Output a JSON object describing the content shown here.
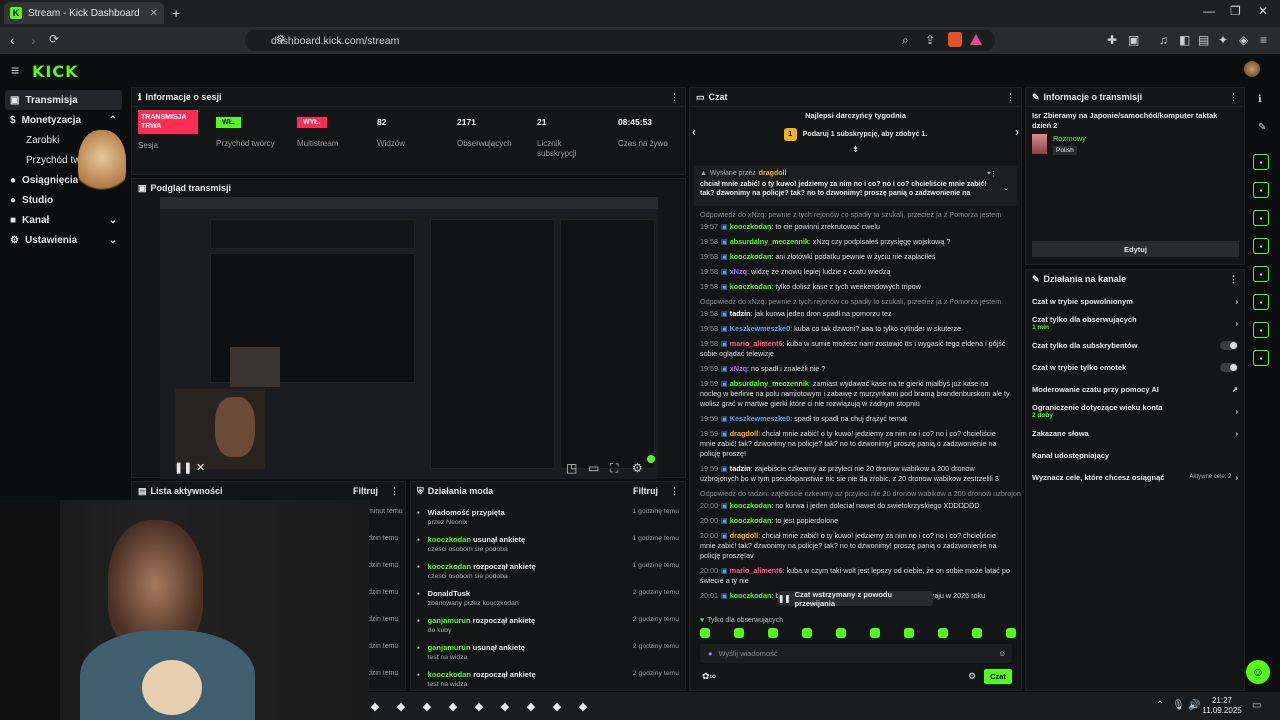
{
  "browser": {
    "tab_title": "Stream - Kick Dashboard",
    "url": "dashboard.kick.com/stream"
  },
  "app": {
    "logo": "KICK"
  },
  "sidebar": {
    "items": [
      {
        "label": "Transmisja",
        "active": true
      },
      {
        "label": "Monetyzacja"
      },
      {
        "label": "Zarobki",
        "sub": true
      },
      {
        "label": "Przychód twórcy",
        "sub": true
      },
      {
        "label": "Osiągnięcia"
      },
      {
        "label": "Studio"
      },
      {
        "label": "Kanał"
      },
      {
        "label": "Ustawienia"
      }
    ]
  },
  "session": {
    "title": "Informacje o sesji",
    "session_label": "Sesja",
    "live_badge": "TRANSMISJA TRWA",
    "creator_badge": "WŁ.",
    "creator_label": "Przychód twórcy",
    "multistream_badge": "WYŁ.",
    "multistream_label": "Multistream",
    "viewers": "82",
    "viewers_label": "Widzów",
    "followers": "2171",
    "followers_label": "Obserwujących",
    "subs": "21",
    "subs_label": "Licznik subskrypcji",
    "time": "08:45:53",
    "time_label": "Czas na żywo"
  },
  "preview": {
    "title": "Podgląd transmisji"
  },
  "activity": {
    "title": "Lista aktywności",
    "filter": "Filtruj",
    "times": [
      "minut temu",
      "dzin temu",
      "dzin temu",
      "dzin temu",
      "dzin temu",
      "dzin temu",
      "dzin temu"
    ]
  },
  "modactions": {
    "title": "Działania moda",
    "filter": "Filtruj",
    "items": [
      {
        "user": "Wiadomość przypięta",
        "action": "",
        "sub": "przez Neonix",
        "time": "1 godzinę temu"
      },
      {
        "user": "kooczkodan",
        "action": " usunął ankietę",
        "sub": "czesci osobom sie podoba",
        "time": "1 godzinę temu"
      },
      {
        "user": "kooczkodan",
        "action": " rozpoczął ankietę",
        "sub": "czesci osobom sie podoba",
        "time": "1 godzinę temu"
      },
      {
        "user": "DonaldTusk",
        "action": "",
        "sub": "zbanowany przez kooczkodan",
        "time": "2 godziny temu"
      },
      {
        "user": "ganjamurun",
        "action": " rozpoczął ankietę",
        "sub": "do kuby",
        "time": "2 godziny temu"
      },
      {
        "user": "ganjamurun",
        "action": " usunął ankietę",
        "sub": "test na widza",
        "time": "2 godziny temu"
      },
      {
        "user": "kooczkodan",
        "action": " rozpoczął ankietę",
        "sub": "test na widza",
        "time": "2 godziny temu"
      }
    ]
  },
  "chat": {
    "title": "Czat",
    "top_gifters": "Najlepsi darczyńcy tygodnia",
    "gift_cta": "Podaruj 1 subskrypcję, aby zdobyć 1.",
    "pinned_by": "Wysłane przez",
    "pinned_user": "dragdoll",
    "pinned_msg": "chciał mnie zabić! o ty kuwo! jedziemy za nim no i co? no i co? chcieliście mnie zabić! tak? dzwonimy na policje? tak? no to dzwonimy! proszę panią o zadzwonienie na policję...",
    "paused": "Czat wstrzymany z powodu przewijania",
    "followers_only": "Tylko dla obserwujących",
    "input_placeholder": "Wyślij wiadomość",
    "send": "Czat",
    "messages": [
      {
        "reply": "Odpowiedź do xNzq: pewnie z tych rejonów co spadły to szukali, przecież ja z Pomorza jestem"
      },
      {
        "t": "19:57",
        "u": "kooczkodan",
        "c": "#53fc18",
        "m": "to cie powinni zrekrutować cwelu"
      },
      {
        "t": "19:58",
        "u": "absurdalny_meczennik",
        "c": "#53fc18",
        "m": "xNzq czy podpisałeś przysięgę wojskową ?"
      },
      {
        "t": "19:58",
        "u": "kooczkodan",
        "c": "#53fc18",
        "m": "ani złotówki podatku pewnie w życiu nie zapłaciłeś"
      },
      {
        "t": "19:58",
        "u": "xNzq",
        "c": "#b26bff",
        "m": "widzę że znowu lepiej ludzie z czatu wiedzą"
      },
      {
        "t": "19:58",
        "u": "kooczkodan",
        "c": "#53fc18",
        "m": "tylko dolisz kase z tych weekendowych tripow"
      },
      {
        "reply": "Odpowiedź do xNzq: pewnie z tych rejonów co spadły to szukali, przecież ja z Pomorza jestem"
      },
      {
        "t": "19:58",
        "u": "tadzin",
        "c": "#ffffff",
        "m": "jak kurwa jeden dron spadł na pomorzu tez"
      },
      {
        "t": "19:58",
        "u": "Keszkewmeszke0",
        "c": "#4fa3ff",
        "m": "kuba co tak dzwoni? aaa to tylko cylinder w skuterze"
      },
      {
        "t": "19:58",
        "u": "mario_aliment6",
        "c": "#ff5a8a",
        "m": "kuba w sumie możesz nam zostawić tts i wygasić tego eldena i pójść sobie oglądać telewizje"
      },
      {
        "t": "19:59",
        "u": "xNzq",
        "c": "#b26bff",
        "m": "no spadł i znaleźli nie ?"
      },
      {
        "t": "19:59",
        "u": "absurdalny_meczennik",
        "c": "#53fc18",
        "m": "zamiast wydawać kase na te gierki miałbyś już kase na nocleg w berlinie na polu namiotowym i zabawę z murzynkami pod bramą brandenburskom ale ty wolisz grać w martwe gierki które ci nie rozwiązują w żadnym stopniu"
      },
      {
        "t": "19:59",
        "u": "Keszkewmeszke0",
        "c": "#4fa3ff",
        "m": "spadł to spadł na chuj drążyć temat"
      },
      {
        "t": "19:59",
        "u": "dragdoll",
        "c": "#ffb020",
        "m": "chciał mnie zabić! o ty kuwo! jedziemy za nim no i co? no i co? chcieliście mnie zabić! tak? dzwonimy na policje? tak? no to dzwonimy! proszę panią o zadzwonienie na policję proszę!"
      },
      {
        "t": "19:59",
        "u": "tadzin",
        "c": "#ffffff",
        "m": "zajebiście czkeamy az przyleci nie 20 dronow wabikow a 200 dronow uzbrojonych bo w tym pseudopanstwie nic sie nie da zrobic, z 20 dronow wabikow zestrzelili 3"
      },
      {
        "reply": "Odpowiedź do tadzin: zajebiście czkeamy az przyleci nie 20 dronow wabikow a 200 dronow uzbrojonyc..."
      },
      {
        "t": "20:00",
        "u": "kooczkodan",
        "c": "#53fc18",
        "m": "no kurwa i jeden doleciał nawet do swietokrzyskiego XDDDDDD"
      },
      {
        "t": "20:00",
        "u": "kooczkodan",
        "c": "#53fc18",
        "m": "to jest popierdolone"
      },
      {
        "t": "20:00",
        "u": "dragdoll",
        "c": "#ffb020",
        "m": "chciał mnie zabić! o ty kuwo! jedziemy za nim no i co? no i co? chcieliście mnie zabić! tak? dzwonimy na policje? tak? no to dzwonimy! proszę panią o zadzwonienie na policję proszę!av"
      },
      {
        "t": "20:00",
        "u": "mario_aliment6",
        "c": "#ff5a8a",
        "m": "kuba w czym taki wolt jest lepszy od ciebie, że on sobie może latać po świecie a ty nie"
      },
      {
        "t": "20:01",
        "u": "kooczkodan",
        "c": "#53fc18",
        "m": "boze kurwa mam nadzieje ze wypierdole z tego kraju w 2026 roku"
      }
    ]
  },
  "streaminfo": {
    "title": "Informacje o transmisji",
    "stream_title": "Isr Zbieramy na Japonie/samochód/komputer taktak dzień 2",
    "category": "Rozmowy",
    "language": "Polish",
    "edit": "Edytuj"
  },
  "channel": {
    "title": "Działania na kanale",
    "items": [
      {
        "label": "Czat w trybie spowolnionym",
        "kind": "arrow"
      },
      {
        "label": "Czat tylko dla obserwujących",
        "sub": "1 min",
        "kind": "arrow"
      },
      {
        "label": "Czat tylko dla subskrybentów",
        "kind": "toggle"
      },
      {
        "label": "Czat w trybie tylko emotek",
        "kind": "toggle"
      },
      {
        "label": "Moderowanie czatu przy pomocy AI",
        "kind": "link"
      },
      {
        "label": "Ograniczenie dotyczące wieku konta",
        "sub": "2 doby",
        "kind": "arrow"
      },
      {
        "label": "Zakazane słowa",
        "kind": "arrow"
      },
      {
        "label": "Kanał udostępniający",
        "kind": "none"
      },
      {
        "label": "Wyznacz cele, które chcesz osiągnąć",
        "note": "Aktywne cele: 2",
        "kind": "arrow"
      }
    ]
  },
  "taskbar": {
    "time": "21:27",
    "date": "11.09.2025"
  },
  "colors": {
    "accent": "#53fc18",
    "live": "#ff2c55",
    "bg": "#0b0d0e",
    "panel": "#141517"
  }
}
